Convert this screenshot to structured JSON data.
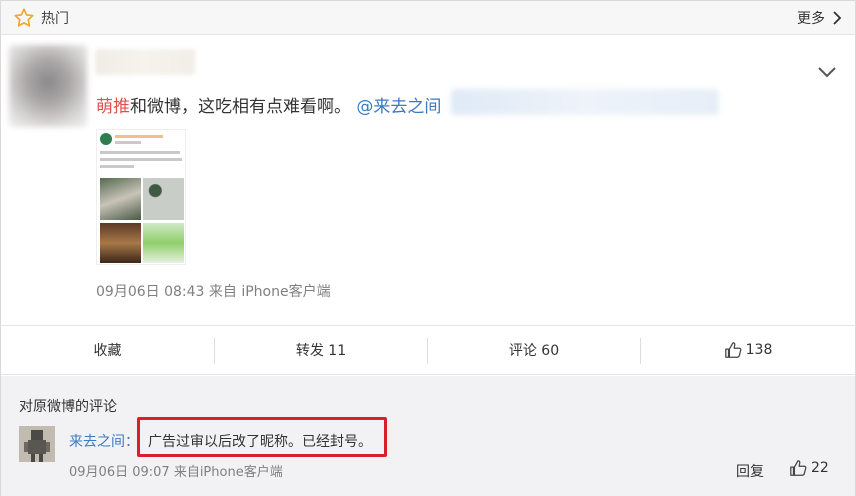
{
  "header": {
    "title": "热门",
    "more_label": "更多"
  },
  "post": {
    "text_brand": "萌推",
    "text_main": "和微博，这吃相有点难看啊。",
    "mention": "@来去之间",
    "meta": "09月06日 08:43  来自 iPhone客户端"
  },
  "actions": {
    "favorite": "收藏",
    "repost": "转发 11",
    "comment": "评论 60",
    "like_count": "138"
  },
  "comments": {
    "section_title": "对原微博的评论",
    "user": "来去之间",
    "text": "广告过审以后改了昵称。已经封号。",
    "meta": "09月06日 09:07  来自iPhone客户端",
    "reply_label": "回复",
    "like_count": "22"
  },
  "colors": {
    "link": "#3b79c1",
    "brand": "#e0504f",
    "highlight": "#d9202a"
  }
}
